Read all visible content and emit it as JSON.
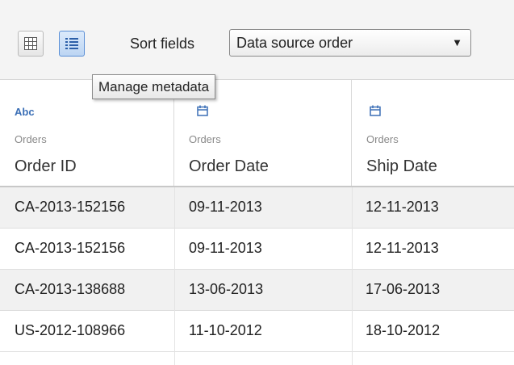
{
  "toolbar": {
    "grid_view_icon": "grid-view-icon",
    "list_view_icon": "list-view-icon",
    "sort_label": "Sort fields",
    "sort_value": "Data source order",
    "tooltip": "Manage metadata"
  },
  "columns": [
    {
      "type": "Abc",
      "type_icon": "string-type-icon",
      "source": "Orders",
      "name": "Order ID"
    },
    {
      "type": "date",
      "type_icon": "calendar-icon",
      "source": "Orders",
      "name": "Order Date"
    },
    {
      "type": "date",
      "type_icon": "calendar-icon",
      "source": "Orders",
      "name": "Ship Date"
    }
  ],
  "rows": [
    [
      "CA-2013-152156",
      "09-11-2013",
      "12-11-2013"
    ],
    [
      "CA-2013-152156",
      "09-11-2013",
      "12-11-2013"
    ],
    [
      "CA-2013-138688",
      "13-06-2013",
      "17-06-2013"
    ],
    [
      "US-2012-108966",
      "11-10-2012",
      "18-10-2012"
    ]
  ],
  "colors": {
    "accent": "#3b6fb6",
    "toolbar_bg": "#f4f4f4",
    "row_shade": "#f1f1f1"
  }
}
